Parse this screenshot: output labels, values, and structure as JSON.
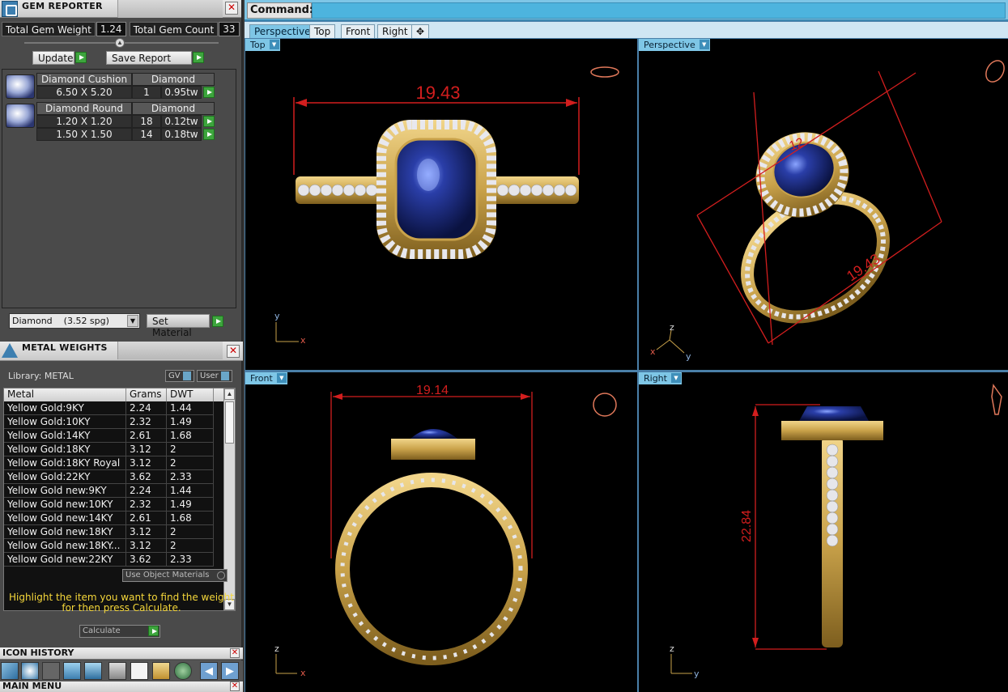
{
  "gem_reporter": {
    "title": "GEM REPORTER",
    "close": "✕",
    "total_weight_label": "Total Gem Weight",
    "total_weight_value": "1.24",
    "total_count_label": "Total Gem Count",
    "total_count_value": "33",
    "update_label": "Update",
    "save_report_label": "Save Report",
    "gems": [
      {
        "name": "Diamond Cushion",
        "type": "Diamond",
        "rows": [
          {
            "size": "6.50 X 5.20",
            "qty": "1",
            "tw": "0.95tw"
          }
        ]
      },
      {
        "name": "Diamond Round",
        "type": "Diamond",
        "rows": [
          {
            "size": "1.20 X 1.20",
            "qty": "18",
            "tw": "0.12tw"
          },
          {
            "size": "1.50 X 1.50",
            "qty": "14",
            "tw": "0.18tw"
          }
        ]
      }
    ],
    "material_select": "Diamond    (3.52 spg)",
    "set_material_label": "Set Material"
  },
  "metal_weights": {
    "title": "METAL WEIGHTS",
    "close": "✕",
    "library_label": "Library: METAL",
    "gv_label": "GV",
    "user_label": "User",
    "columns": [
      "Metal",
      "Grams",
      "DWT"
    ],
    "rows": [
      [
        "Yellow Gold:9KY",
        "2.24",
        "1.44"
      ],
      [
        "Yellow Gold:10KY",
        "2.32",
        "1.49"
      ],
      [
        "Yellow Gold:14KY",
        "2.61",
        "1.68"
      ],
      [
        "Yellow Gold:18KY",
        "3.12",
        "2"
      ],
      [
        "Yellow Gold:18KY Royal",
        "3.12",
        "2"
      ],
      [
        "Yellow Gold:22KY",
        "3.62",
        "2.33"
      ],
      [
        "Yellow Gold new:9KY",
        "2.24",
        "1.44"
      ],
      [
        "Yellow Gold new:10KY",
        "2.32",
        "1.49"
      ],
      [
        "Yellow Gold new:14KY",
        "2.61",
        "1.68"
      ],
      [
        "Yellow Gold new:18KY",
        "3.12",
        "2"
      ],
      [
        "Yellow Gold new:18KY...",
        "3.12",
        "2"
      ],
      [
        "Yellow Gold new:22KY",
        "3.62",
        "2.33"
      ]
    ],
    "use_object_materials": "Use Object Materials",
    "hint_line1": "Highlight the item you want to find the weight",
    "hint_line2": "for then press Calculate.",
    "calculate_label": "Calculate"
  },
  "icon_history": {
    "title": "ICON HISTORY",
    "close": "✕"
  },
  "main_menu": {
    "title": "MAIN MENU",
    "close": "✕"
  },
  "command": {
    "label": "Command:"
  },
  "view_tabs": [
    "Perspective",
    "Top",
    "Front",
    "Right",
    "✥"
  ],
  "viewports": {
    "top": {
      "label": "Top",
      "dimension": "19.43",
      "axis_y": "y",
      "axis_x": "x"
    },
    "perspective": {
      "label": "Perspective",
      "dimension": "19.43",
      "dimension2": "12",
      "axis_z": "z",
      "axis_x": "x",
      "axis_y": "y"
    },
    "front": {
      "label": "Front",
      "dimension": "19.14",
      "axis_z": "z",
      "axis_x": "x"
    },
    "right": {
      "label": "Right",
      "dimension": "22.84",
      "axis_z": "z",
      "axis_y": "y"
    }
  },
  "colors": {
    "accent": "#7ec6e6",
    "dimension_red": "#d21e1e",
    "gold": "#c9a24a",
    "sapphire": "#1a2f80",
    "hint_yellow": "#f5d73a"
  }
}
